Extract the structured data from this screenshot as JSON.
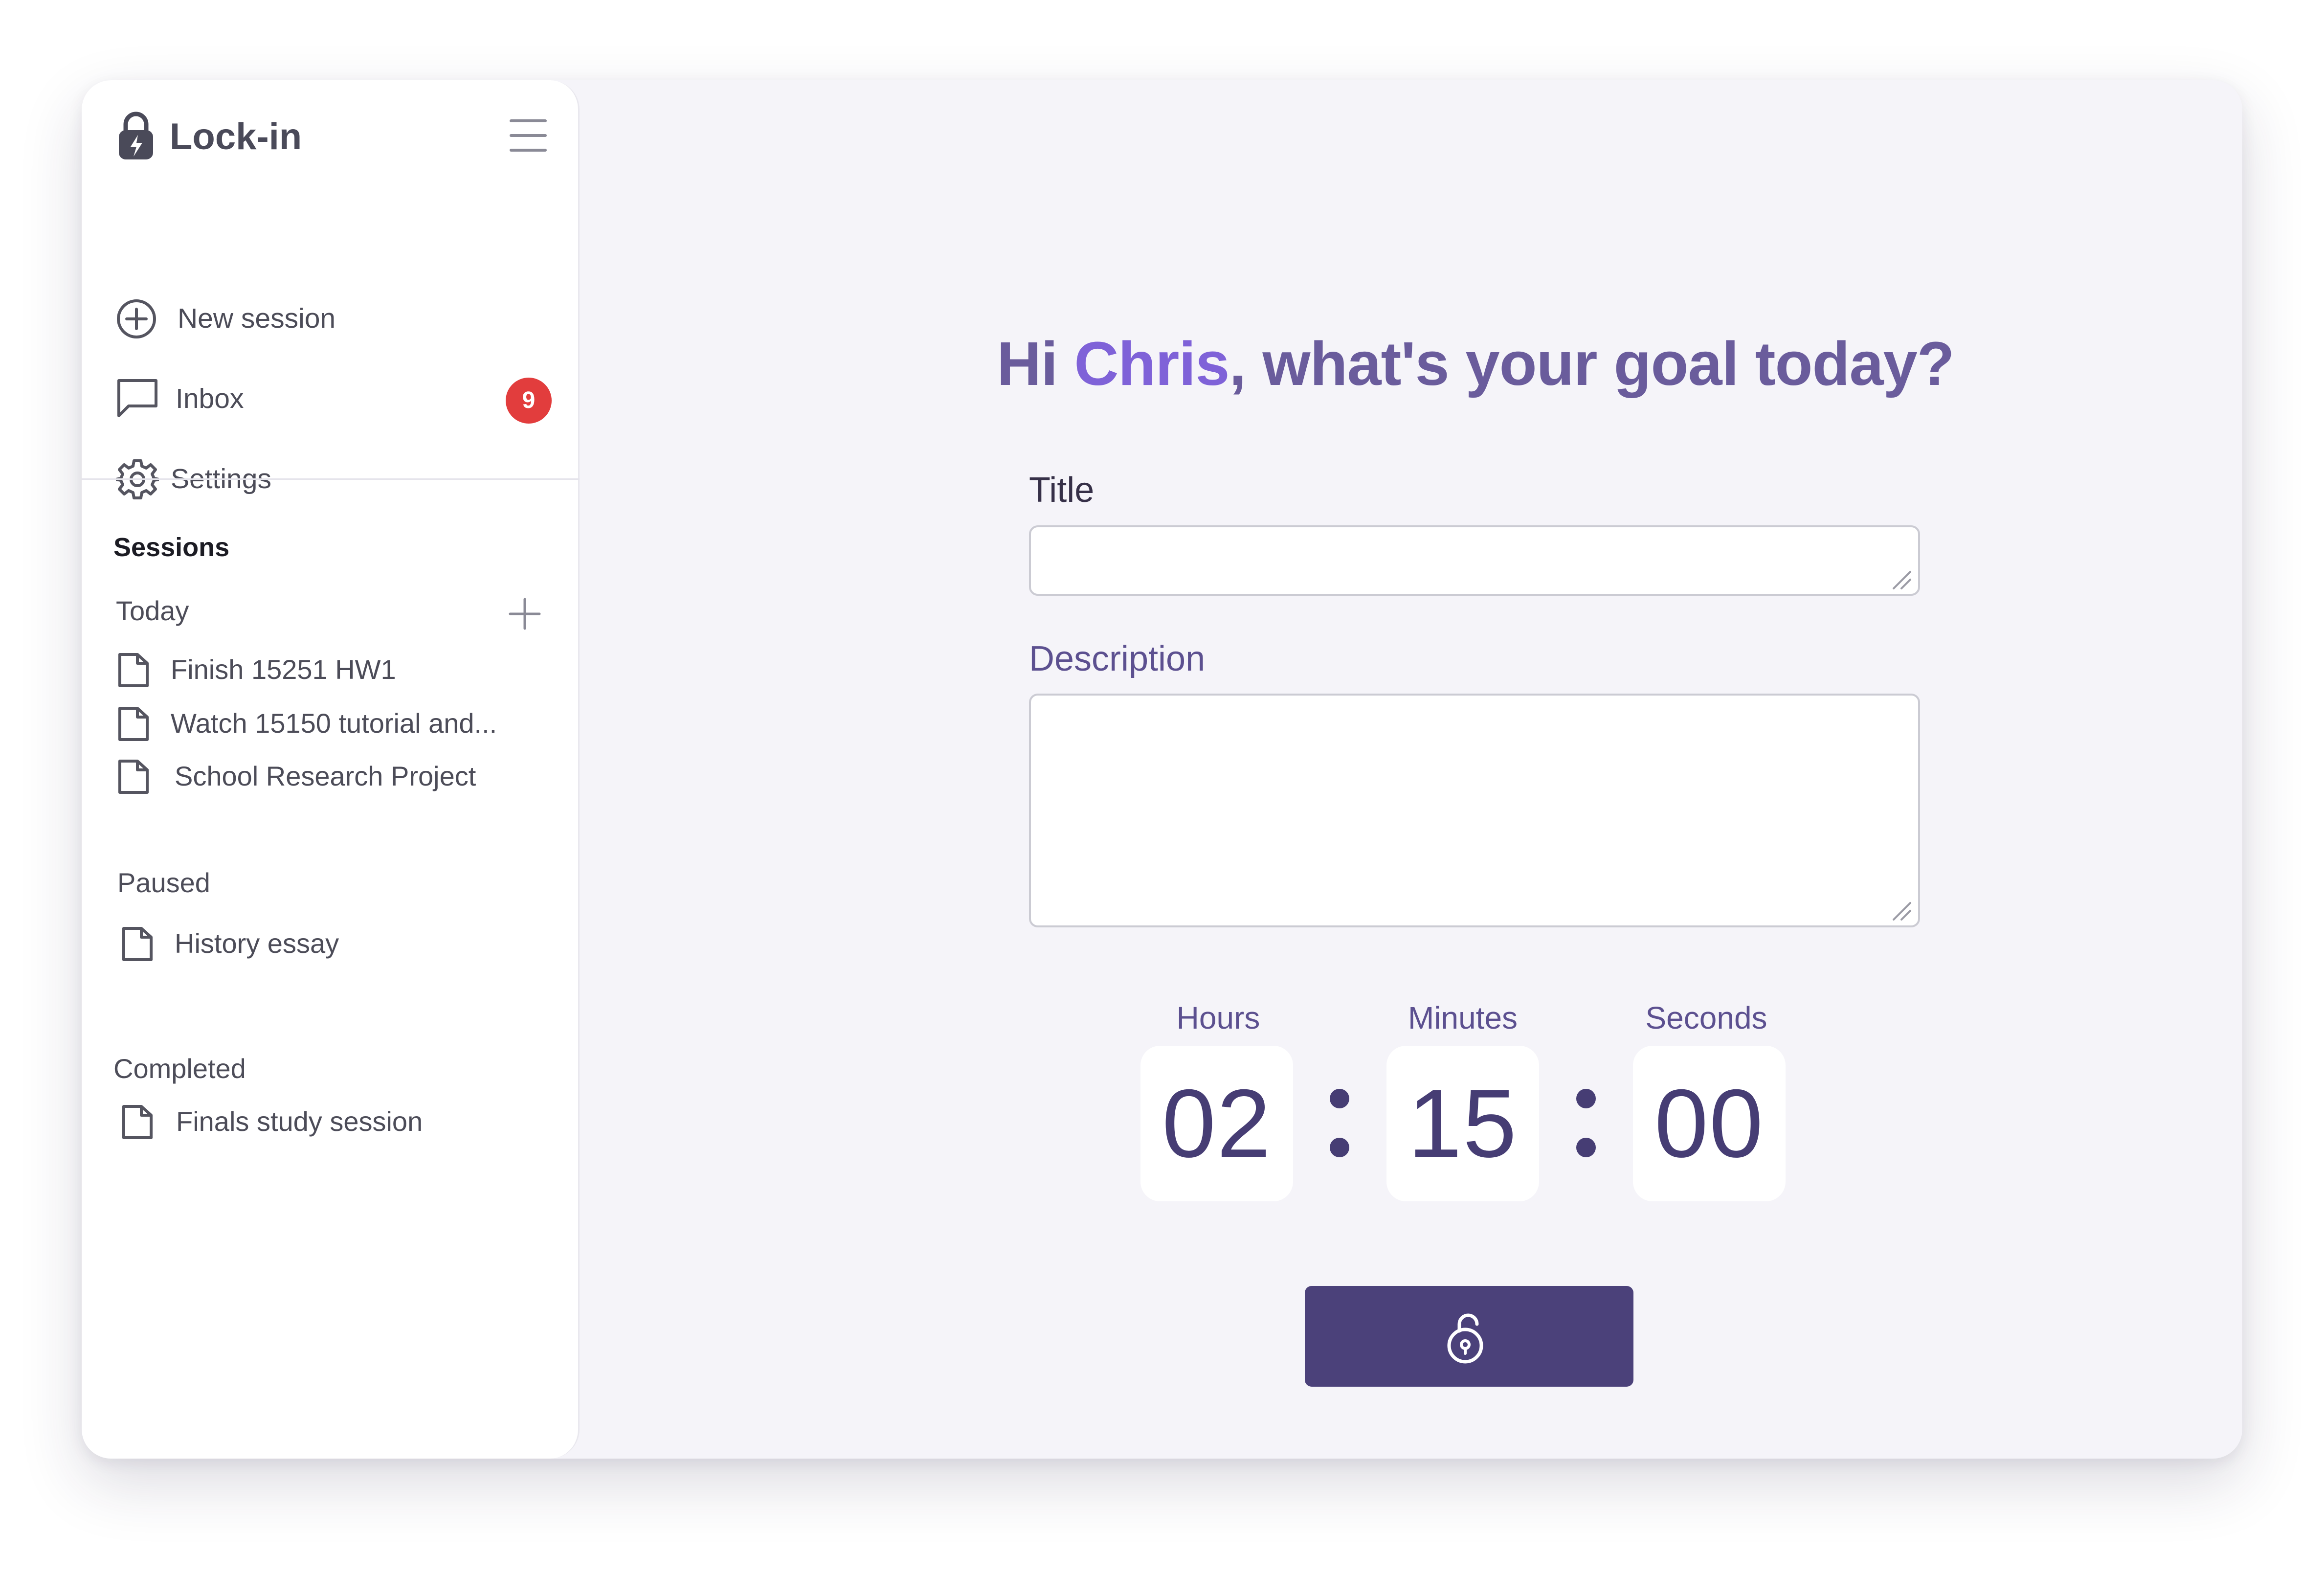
{
  "app": {
    "title": "Lock-in",
    "logo_icon": "padlock-bolt-icon",
    "menu_icon": "hamburger-menu-icon"
  },
  "nav": {
    "items": [
      {
        "label": "New session",
        "icon": "plus-circle-icon"
      },
      {
        "label": "Inbox",
        "icon": "chat-bubble-icon",
        "badge": "9"
      },
      {
        "label": "Settings",
        "icon": "gear-icon"
      }
    ]
  },
  "sessions": {
    "heading": "Sessions",
    "add_icon": "plus-icon",
    "groups": [
      {
        "label": "Today",
        "items": [
          {
            "label": "Finish 15251 HW1"
          },
          {
            "label": "Watch 15150 tutorial and..."
          },
          {
            "label": "School Research Project"
          }
        ]
      },
      {
        "label": "Paused",
        "items": [
          {
            "label": "History essay"
          }
        ]
      },
      {
        "label": "Completed",
        "items": [
          {
            "label": "Finals study session"
          }
        ]
      }
    ]
  },
  "main": {
    "greeting_prefix": "Hi ",
    "user_name": "Chris",
    "greeting_suffix": ", what's your goal today?",
    "title_label": "Title",
    "title_value": "",
    "description_label": "Description",
    "description_value": "",
    "timer": {
      "hours_label": "Hours",
      "minutes_label": "Minutes",
      "seconds_label": "Seconds",
      "hours": "02",
      "minutes": "15",
      "seconds": "00"
    },
    "start_button_icon": "unlocked-padlock-icon"
  },
  "colors": {
    "accent": "#4b417a",
    "name_highlight": "#7f62d8",
    "heading": "#6a5c9c",
    "badge": "#e23d3d"
  }
}
